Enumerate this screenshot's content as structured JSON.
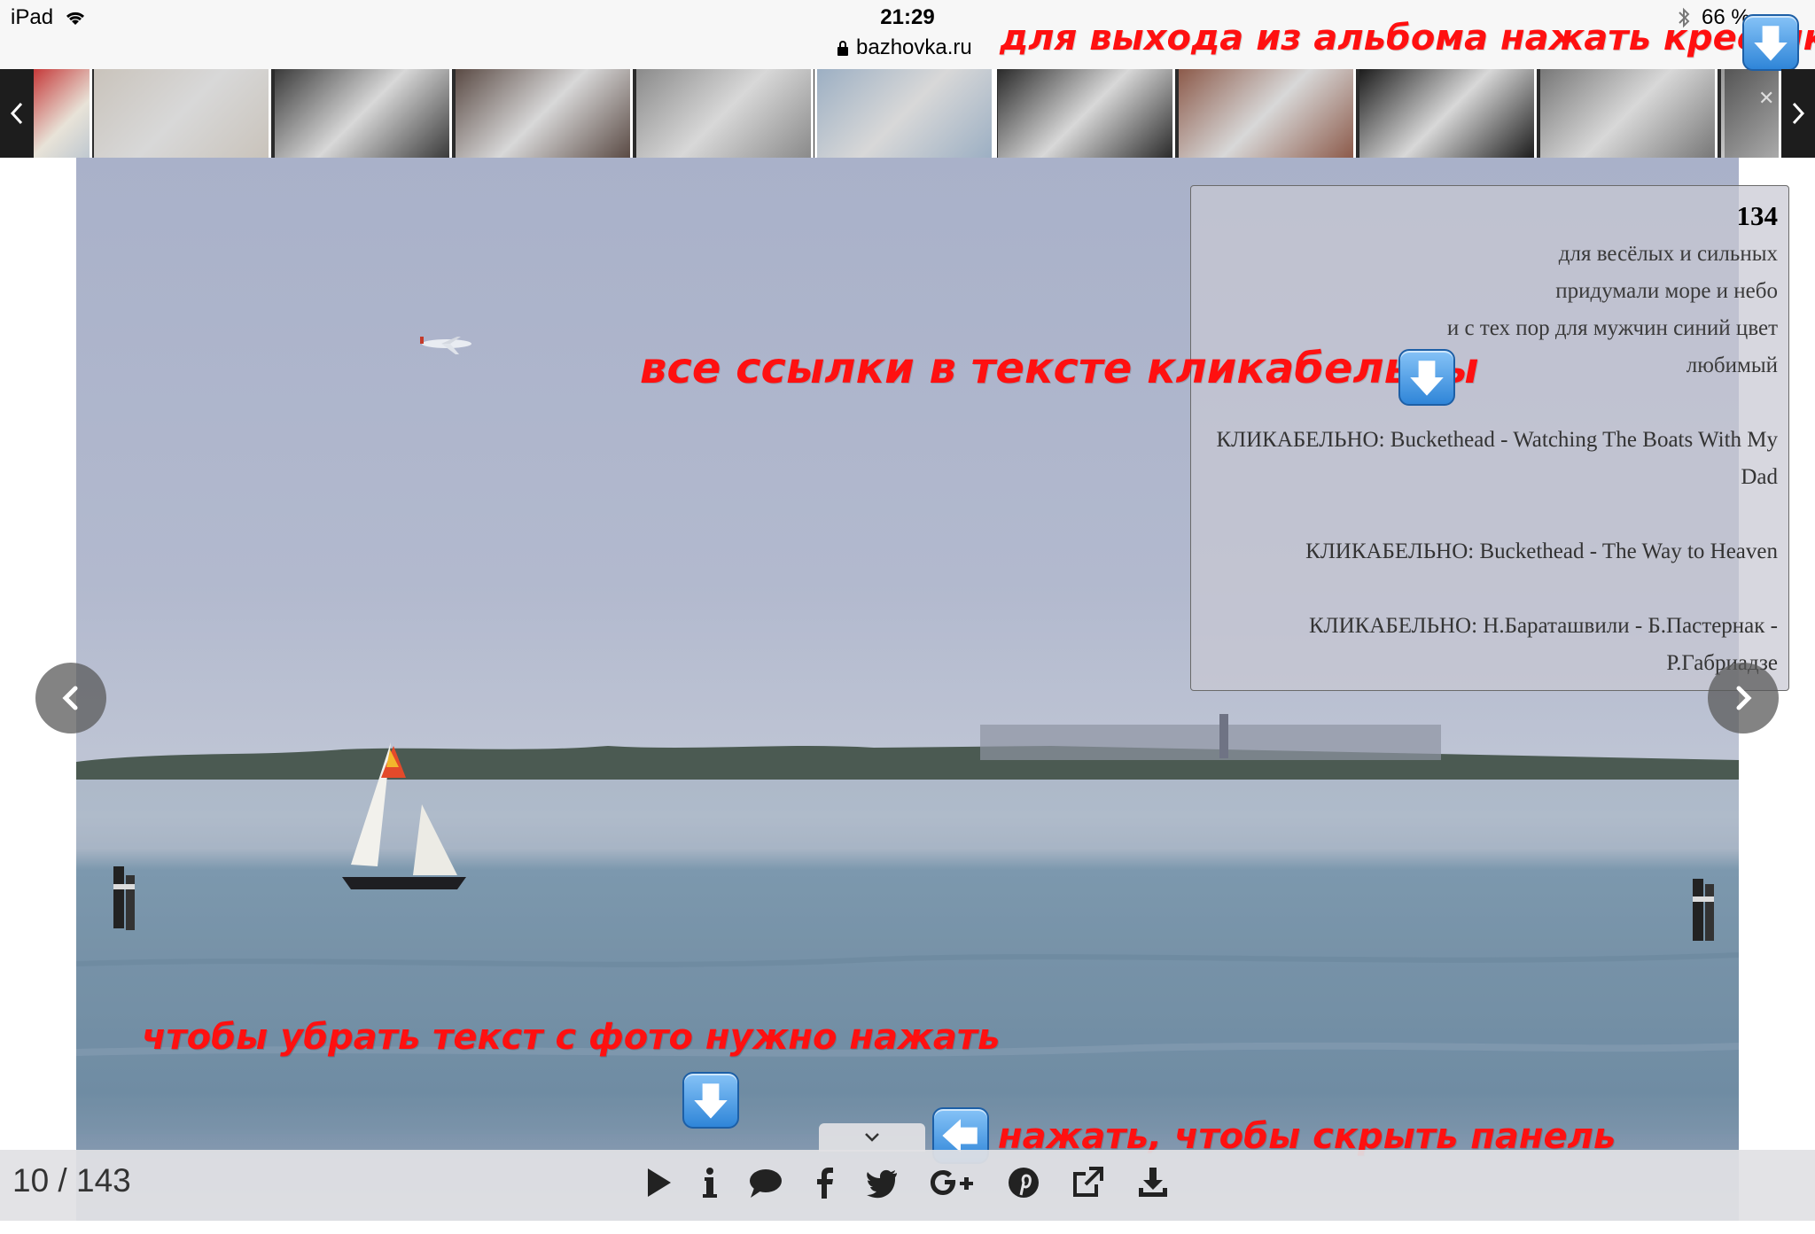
{
  "statusbar": {
    "device": "iPad",
    "time": "21:29",
    "url": "bazhovka.ru",
    "battery": "66 %"
  },
  "hints": {
    "exit_album": "для выхода из альбома нажать крестик",
    "links_clickable": "все ссылки в тексте кликабельны",
    "remove_text": "чтобы убрать текст с фото нужно нажать",
    "hide_panel": "нажать, чтобы скрыть панель"
  },
  "description": {
    "number": "134",
    "lines": [
      "для весёлых и сильных",
      "придумали море и небо",
      "и с тех пор для мужчин синий цвет",
      "любимый"
    ],
    "links": [
      "КЛИКАБЕЛЬНО: Buckethead - Watching The Boats With My Dad",
      "КЛИКАБЕЛЬНО: Buckethead - The Way to Heaven",
      "КЛИКАБЕЛЬНО: Н.Бараташвили - Б.Пастернак - Р.Габриадзе"
    ]
  },
  "gallery": {
    "counter": "10 / 143",
    "thumbnail_count": 10,
    "thumbnail_colors": [
      "#c9c3bb",
      "#3a3a3a",
      "#5a4a44",
      "#8a8a8a",
      "#9cafc3",
      "#2a2a2a",
      "#8c5a4a",
      "#1c1c1c",
      "#777777",
      "#999999"
    ]
  },
  "toolbar": {
    "icons": [
      "play-icon",
      "info-icon",
      "comment-icon",
      "facebook-icon",
      "twitter-icon",
      "google-plus-icon",
      "pinterest-icon",
      "open-external-icon",
      "download-icon"
    ]
  },
  "colors": {
    "hint_red": "#ff1010",
    "emoji_blue": "#2f85d8"
  }
}
